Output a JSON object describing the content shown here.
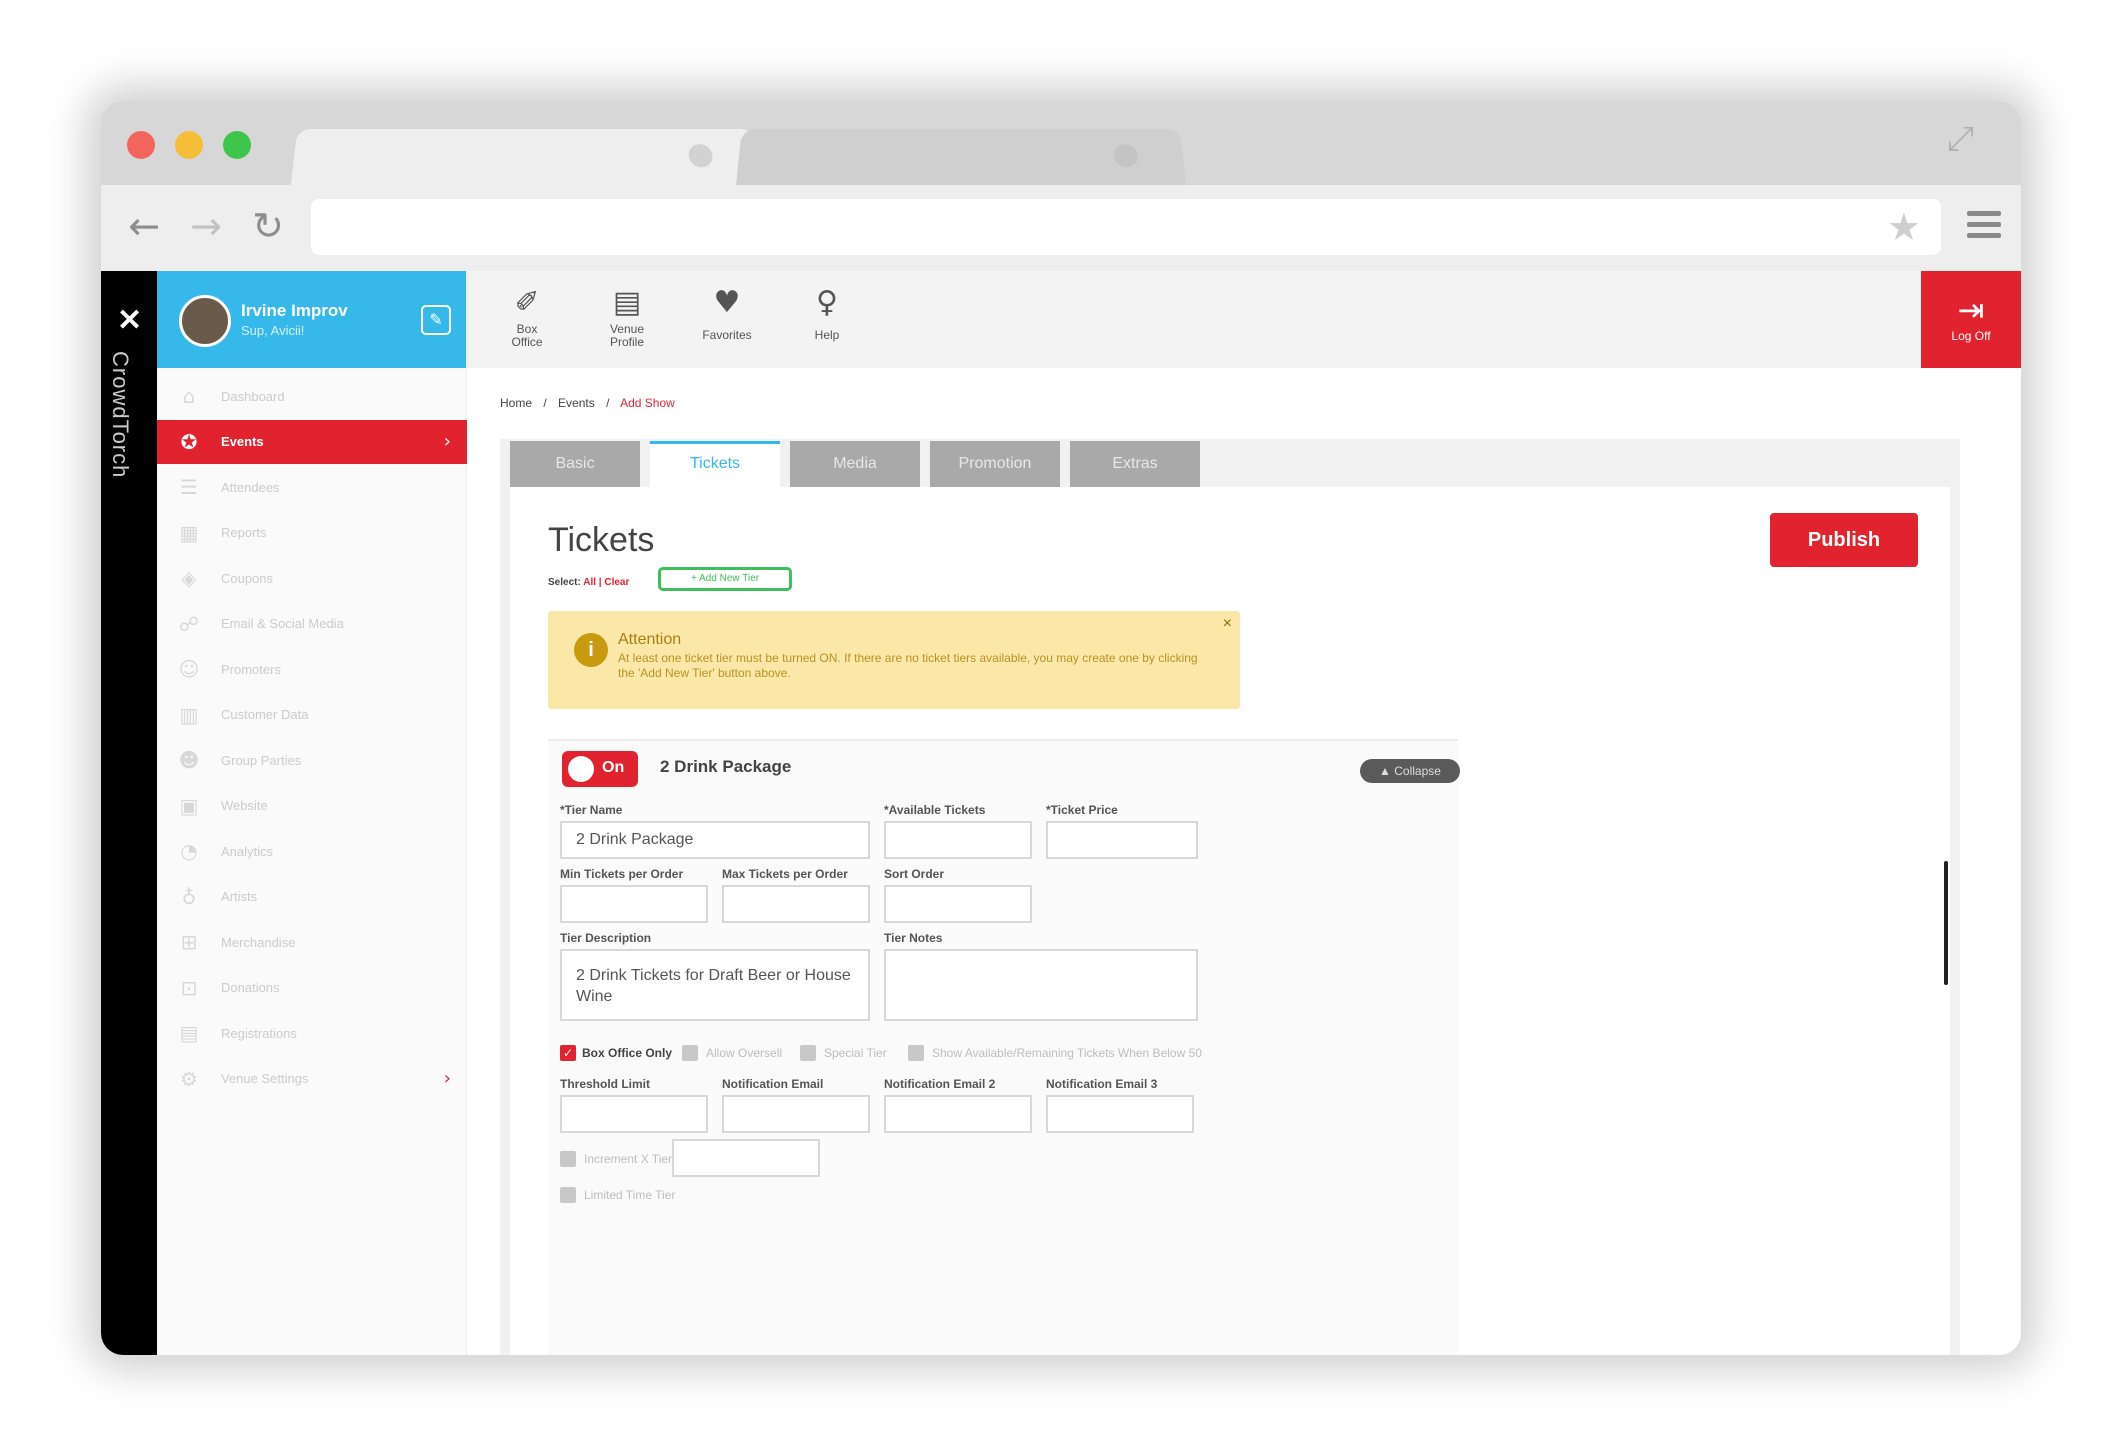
{
  "browser": {
    "url": "",
    "icons": {
      "back": "arrow-left-icon",
      "forward": "arrow-right-icon",
      "reload": "reload-icon",
      "star": "star-icon",
      "menu": "hamburger-icon",
      "fullscreen": "expand-icon"
    }
  },
  "brand": {
    "vertical_text": "CrowdTorch"
  },
  "profile": {
    "name": "Irvine Improv",
    "subtitle": "Sup, Avicii!"
  },
  "sidebar": {
    "items": [
      {
        "label": "Dashboard",
        "icon": "house-icon"
      },
      {
        "label": "Events",
        "icon": "ribbon-icon",
        "active": true
      },
      {
        "label": "Attendees",
        "icon": "list-icon"
      },
      {
        "label": "Reports",
        "icon": "chart-icon"
      },
      {
        "label": "Coupons",
        "icon": "tag-icon"
      },
      {
        "label": "Email & Social Media",
        "icon": "share-icon"
      },
      {
        "label": "Promoters",
        "icon": "person-icon"
      },
      {
        "label": "Customer Data",
        "icon": "database-icon"
      },
      {
        "label": "Group Parties",
        "icon": "group-icon"
      },
      {
        "label": "Website",
        "icon": "browser-icon"
      },
      {
        "label": "Analytics",
        "icon": "analytics-icon"
      },
      {
        "label": "Artists",
        "icon": "microphone-icon"
      },
      {
        "label": "Merchandise",
        "icon": "cart-icon"
      },
      {
        "label": "Donations",
        "icon": "lock-icon"
      },
      {
        "label": "Registrations",
        "icon": "form-icon"
      },
      {
        "label": "Venue Settings",
        "icon": "gear-icon"
      }
    ]
  },
  "topnav": {
    "items": [
      {
        "label1": "Box",
        "label2": "Office",
        "icon": "ticket-icon"
      },
      {
        "label1": "Venue",
        "label2": "Profile",
        "icon": "book-icon"
      },
      {
        "label1": "Favorites",
        "label2": "",
        "icon": "heart-icon"
      },
      {
        "label1": "Help",
        "label2": "",
        "icon": "lightbulb-icon"
      }
    ],
    "logoff": "Log Off"
  },
  "breadcrumb": {
    "home": "Home",
    "sep": "/",
    "events": "Events",
    "current": "Add Show"
  },
  "tabs": [
    "Basic",
    "Tickets",
    "Media",
    "Promotion",
    "Extras"
  ],
  "page": {
    "title": "Tickets",
    "select_label": "Select:",
    "select_all": "All",
    "select_sep": "|",
    "select_clear": "Clear",
    "add_tier": "+ Add New Tier",
    "publish": "Publish"
  },
  "attention": {
    "title": "Attention",
    "body": "At least one ticket tier must be turned ON. If there are no ticket tiers available, you may create one by clicking the 'Add New Tier' button above.",
    "icon": "info-icon",
    "close": "×"
  },
  "tier": {
    "toggle": "On",
    "name": "2 Drink Package",
    "collapse": "▲ Collapse",
    "labels": {
      "tier_name": "*Tier Name",
      "available": "*Available Tickets",
      "price": "*Ticket Price",
      "min": "Min Tickets per Order",
      "max": "Max Tickets per Order",
      "sort": "Sort Order",
      "description": "Tier Description",
      "notes": "Tier Notes",
      "threshold": "Threshold Limit",
      "email1": "Notification Email",
      "email2": "Notification Email 2",
      "email3": "Notification Email 3"
    },
    "values": {
      "tier_name": "2 Drink Package",
      "description": "2 Drink Tickets for Draft Beer or House Wine"
    },
    "checkboxes": {
      "box_office_only": "Box Office Only",
      "allow_oversell": "Allow Oversell",
      "special_tier": "Special Tier",
      "show_available": "Show Available/Remaining Tickets When Below 50",
      "increment": "Increment X Tier",
      "limited_time": "Limited Time Tier"
    }
  }
}
